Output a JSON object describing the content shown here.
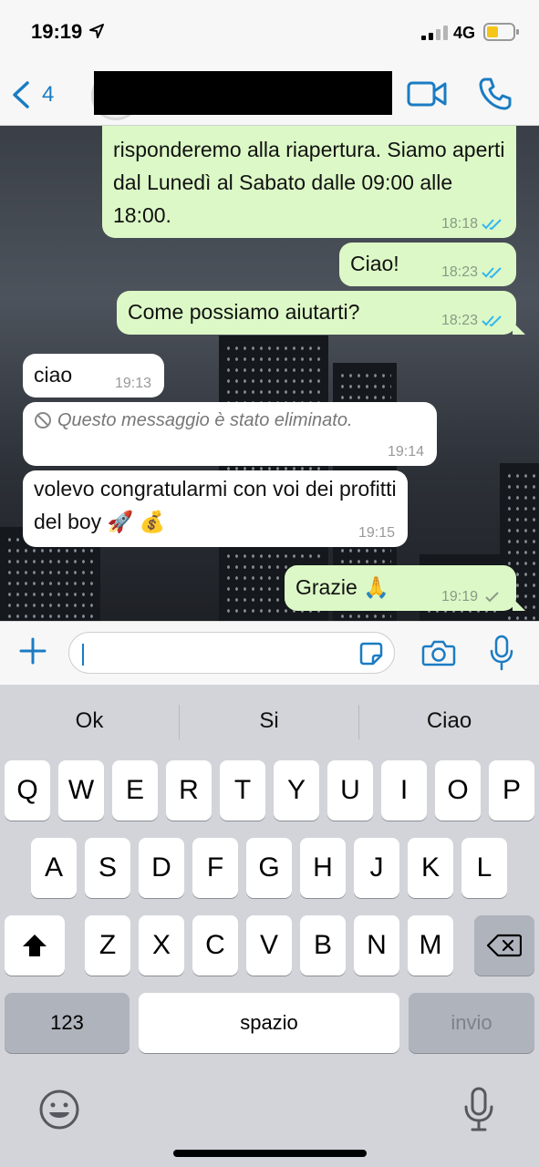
{
  "status_bar": {
    "time": "19:19",
    "network": "4G"
  },
  "header": {
    "back_count": "4"
  },
  "messages": [
    {
      "dir": "out",
      "text": "risponderemo alla riapertura. Siamo aperti dal Lunedì al Sabato dalle 09:00 alle 18:00.",
      "time": "18:18",
      "status": "read"
    },
    {
      "dir": "out",
      "text": "Ciao!",
      "time": "18:23",
      "status": "read"
    },
    {
      "dir": "out",
      "text": "Come possiamo aiutarti?",
      "time": "18:23",
      "status": "read"
    },
    {
      "dir": "in",
      "text": "ciao",
      "time": "19:13"
    },
    {
      "dir": "in",
      "text": "Questo messaggio è stato eliminato.",
      "time": "19:14",
      "deleted": true
    },
    {
      "dir": "in",
      "text": "volevo congratularmi con voi dei profitti del boy 🚀 💰",
      "time": "19:15"
    },
    {
      "dir": "out",
      "text": "Grazie 🙏",
      "time": "19:19",
      "status": "sent"
    }
  ],
  "composer": {
    "input_value": ""
  },
  "keyboard": {
    "suggestions": [
      "Ok",
      "Si",
      "Ciao"
    ],
    "rows": [
      [
        "Q",
        "W",
        "E",
        "R",
        "T",
        "Y",
        "U",
        "I",
        "O",
        "P"
      ],
      [
        "A",
        "S",
        "D",
        "F",
        "G",
        "H",
        "J",
        "K",
        "L"
      ],
      [
        "Z",
        "X",
        "C",
        "V",
        "B",
        "N",
        "M"
      ]
    ],
    "numbers_label": "123",
    "space_label": "spazio",
    "return_label": "invio"
  },
  "colors": {
    "accent": "#1b7cc3",
    "outgoing_bubble": "#dcf8c6",
    "incoming_bubble": "#ffffff",
    "read_tick": "#34b7f1"
  },
  "icons": [
    "location-arrow-icon",
    "signal-icon",
    "battery-icon",
    "back-chevron-icon",
    "video-call-icon",
    "phone-icon",
    "read-ticks-icon",
    "sent-tick-icon",
    "ban-icon",
    "plus-icon",
    "sticker-icon",
    "camera-icon",
    "mic-icon",
    "shift-icon",
    "backspace-icon",
    "emoji-icon",
    "dictation-mic-icon"
  ]
}
